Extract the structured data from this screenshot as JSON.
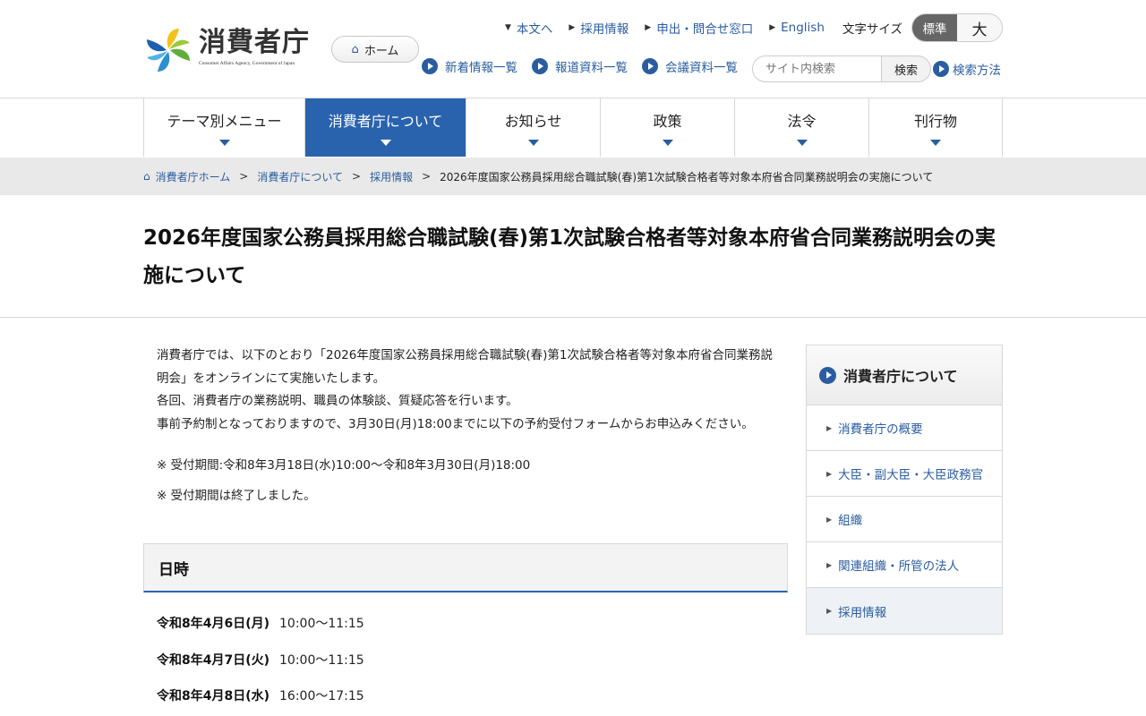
{
  "header": {
    "logo_text": "消費者庁",
    "logo_subtext": "Consumer Affairs Agency, Government of Japan",
    "home_label": "ホーム",
    "top_links": [
      {
        "label": "本文へ",
        "marker": "down"
      },
      {
        "label": "採用情報",
        "marker": "right"
      },
      {
        "label": "申出・問合せ窓口",
        "marker": "right"
      },
      {
        "label": "English",
        "marker": "right"
      }
    ],
    "font_size_label": "文字サイズ",
    "font_size_standard": "標準",
    "font_size_large": "大",
    "sub_links": [
      "新着情報一覧",
      "報道資料一覧",
      "会議資料一覧"
    ],
    "search_placeholder": "サイト内検索",
    "search_button": "検索",
    "search_help": "検索方法"
  },
  "main_menu": [
    {
      "label": "テーマ別メニュー",
      "active": false
    },
    {
      "label": "消費者庁について",
      "active": true
    },
    {
      "label": "お知らせ",
      "active": false
    },
    {
      "label": "政策",
      "active": false
    },
    {
      "label": "法令",
      "active": false
    },
    {
      "label": "刊行物",
      "active": false
    }
  ],
  "breadcrumb": {
    "items": [
      "消費者庁ホーム",
      "消費者庁について",
      "採用情報"
    ],
    "current": "2026年度国家公務員採用総合職試験(春)第1次試験合格者等対象本府省合同業務説明会の実施について"
  },
  "page_title": "2026年度国家公務員採用総合職試験(春)第1次試験合格者等対象本府省合同業務説明会の実施について",
  "intro": {
    "line1": "消費者庁では、以下のとおり「2026年度国家公務員採用総合職試験(春)第1次試験合格者等対象本府省合同業務説明会」をオンラインにて実施いたします。",
    "line2": "各回、消費者庁の業務説明、職員の体験談、質疑応答を行います。",
    "line3": "事前予約制となっておりますので、3月30日(月)18:00までに以下の予約受付フォームからお申込みください。"
  },
  "notes": {
    "period": "※ 受付期間:令和8年3月18日(水)10:00～令和8年3月30日(月)18:00",
    "closed": "※ 受付期間は終了しました。"
  },
  "schedule_section": {
    "heading": "日時",
    "rows": [
      {
        "date": "令和8年4月6日(月)",
        "time": "10:00～11:15"
      },
      {
        "date": "令和8年4月7日(火)",
        "time": "10:00～11:15"
      },
      {
        "date": "令和8年4月8日(水)",
        "time": "16:00～17:15"
      }
    ]
  },
  "sidebar": {
    "heading": "消費者庁について",
    "items": [
      {
        "label": "消費者庁の概要",
        "active": false
      },
      {
        "label": "大臣・副大臣・大臣政務官",
        "active": false
      },
      {
        "label": "組織",
        "active": false
      },
      {
        "label": "関連組織・所管の法人",
        "active": false
      },
      {
        "label": "採用情報",
        "active": true
      }
    ]
  },
  "colors": {
    "accent": "#2a63ad",
    "link": "#2a5d9f",
    "breadcrumb_bg": "#e9e9e9"
  }
}
